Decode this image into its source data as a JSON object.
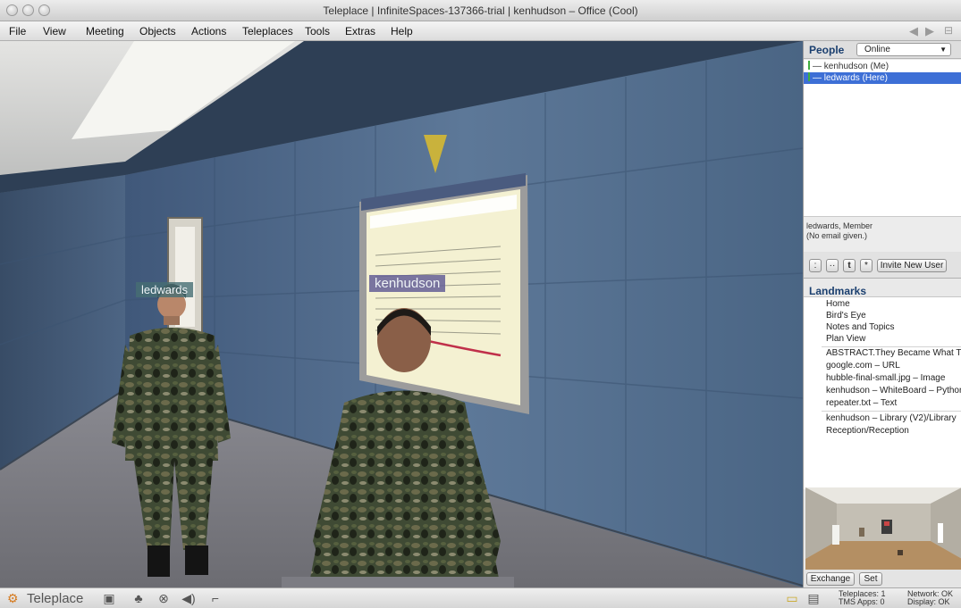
{
  "window": {
    "title": "Teleplace  |  InfiniteSpaces-137366-trial  |  kenhudson – Office (Cool)"
  },
  "menu": {
    "items": [
      "File",
      "View",
      "Meeting",
      "Objects",
      "Actions",
      "Teleplaces",
      "Tools",
      "Extras",
      "Help"
    ]
  },
  "scene": {
    "avatar_tags": {
      "left": "ledwards",
      "center": "kenhudson"
    },
    "whiteboard_title": "kenhudson – WhiteBoard – Python"
  },
  "people": {
    "title": "People",
    "filter": "Online",
    "list": [
      {
        "name": "— kenhudson  (Me)",
        "selected": false
      },
      {
        "name": "— ledwards  (Here)",
        "selected": true
      }
    ],
    "member_info_line1": "ledwards, Member",
    "member_info_line2": "(No email given.)",
    "tools": [
      ":",
      "··",
      "t",
      "*"
    ],
    "invite_label": "Invite New User"
  },
  "landmarks": {
    "title": "Landmarks",
    "group1": [
      "Home",
      "Bird's Eye",
      "Notes and Topics",
      "Plan View"
    ],
    "group2": [
      "ABSTRACT.They Became What They",
      "google.com – URL",
      "hubble-final-small.jpg – Image",
      "kenhudson – WhiteBoard – Python",
      "repeater.txt – Text"
    ],
    "group3": [
      "kenhudson – Library (V2)/Library",
      "Reception/Reception"
    ]
  },
  "panel_footer": {
    "exchange_label": "Exchange",
    "set_label": "Set"
  },
  "statusbar": {
    "brand": "Teleplace",
    "teleplaces": "Teleplaces:  1",
    "tms_apps": "TMS Apps:   0",
    "network": "Network: OK",
    "display": "Display:  OK"
  },
  "colors": {
    "selection": "#3d6fd6",
    "panel_heading": "#1a3f6f",
    "wall": "#4f6a88",
    "floor": "#7f7f86"
  }
}
